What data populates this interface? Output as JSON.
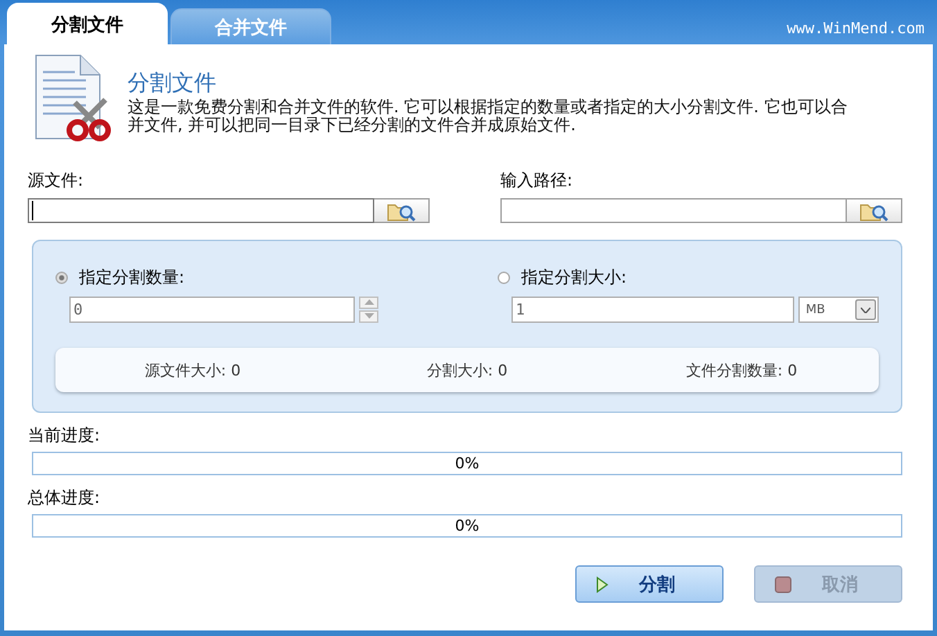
{
  "tabs": [
    {
      "label": "分割文件",
      "selected": true
    },
    {
      "label": "合并文件",
      "selected": false
    }
  ],
  "website": "www.WinMend.com",
  "header": {
    "title": "分割文件",
    "description": "这是一款免费分割和合并文件的软件. 它可以根据指定的数量或者指定的大小分割文件.  它也可以合并文件, 并可以把同一目录下已经分割的文件合并成原始文件."
  },
  "paths": [
    {
      "label": "源文件:",
      "focused": true
    },
    {
      "label": "输入路径:",
      "focused": false
    }
  ],
  "split_options": [
    {
      "kind": "spinner",
      "label": "指定分割数量:",
      "selected": true,
      "value": "0"
    },
    {
      "kind": "unit",
      "label": "指定分割大小:",
      "selected": false,
      "value": "1",
      "unit": "MB"
    }
  ],
  "info": [
    "源文件大小: 0",
    "分割大小: 0",
    "文件分割数量: 0"
  ],
  "progress": [
    {
      "label": "当前进度:",
      "level": 0,
      "reading": "0%"
    },
    {
      "label": "总体进度:",
      "level": 0,
      "reading": "0%"
    }
  ],
  "buttons": [
    {
      "kind": "split",
      "label": "分割",
      "disabled": false
    },
    {
      "kind": "cancel",
      "label": "取消",
      "disabled": true
    }
  ]
}
